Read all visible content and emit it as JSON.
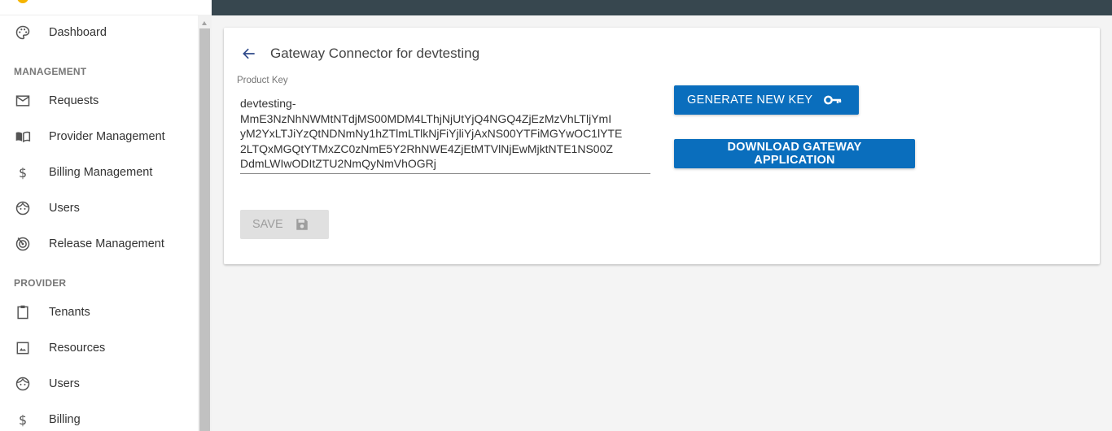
{
  "sidebar": {
    "items": [
      {
        "label": "Dashboard",
        "icon": "palette-icon"
      },
      {
        "label": "Requests",
        "icon": "mail-icon"
      },
      {
        "label": "Provider Management",
        "icon": "book-open-icon"
      },
      {
        "label": "Billing Management",
        "icon": "dollar-icon"
      },
      {
        "label": "Users",
        "icon": "face-icon"
      },
      {
        "label": "Release Management",
        "icon": "radar-icon"
      },
      {
        "label": "Tenants",
        "icon": "clipboard-icon"
      },
      {
        "label": "Resources",
        "icon": "image-icon"
      },
      {
        "label": "Users",
        "icon": "face-icon"
      },
      {
        "label": "Billing",
        "icon": "dollar-icon"
      }
    ],
    "sections": {
      "management": "MANAGEMENT",
      "provider": "PROVIDER"
    }
  },
  "card": {
    "title": "Gateway Connector for devtesting",
    "product_key_label": "Product Key",
    "product_key_lines": [
      "devtesting-",
      "MmE3NzNhNWMtNTdjMS00MDM4LThjNjUtYjQ4NGQ4ZjEzMzVhLTljYmI",
      "yM2YxLTJiYzQtNDNmNy1hZTlmLTlkNjFiYjliYjAxNS00YTFiMGYwOC1lYTE",
      "2LTQxMGQtYTMxZC0zNmE5Y2RhNWE4ZjEtMTVlNjEwMjktNTE1NS00Z",
      "DdmLWIwODItZTU2NmQyNmVhOGRj"
    ],
    "generate_label": "GENERATE NEW KEY",
    "download_label": "DOWNLOAD GATEWAY APPLICATION",
    "save_label": "SAVE"
  },
  "colors": {
    "topbar": "#37474f",
    "primary": "#0a6ebd",
    "disabled": "#e0e0e0",
    "logo": "#f5b400"
  }
}
